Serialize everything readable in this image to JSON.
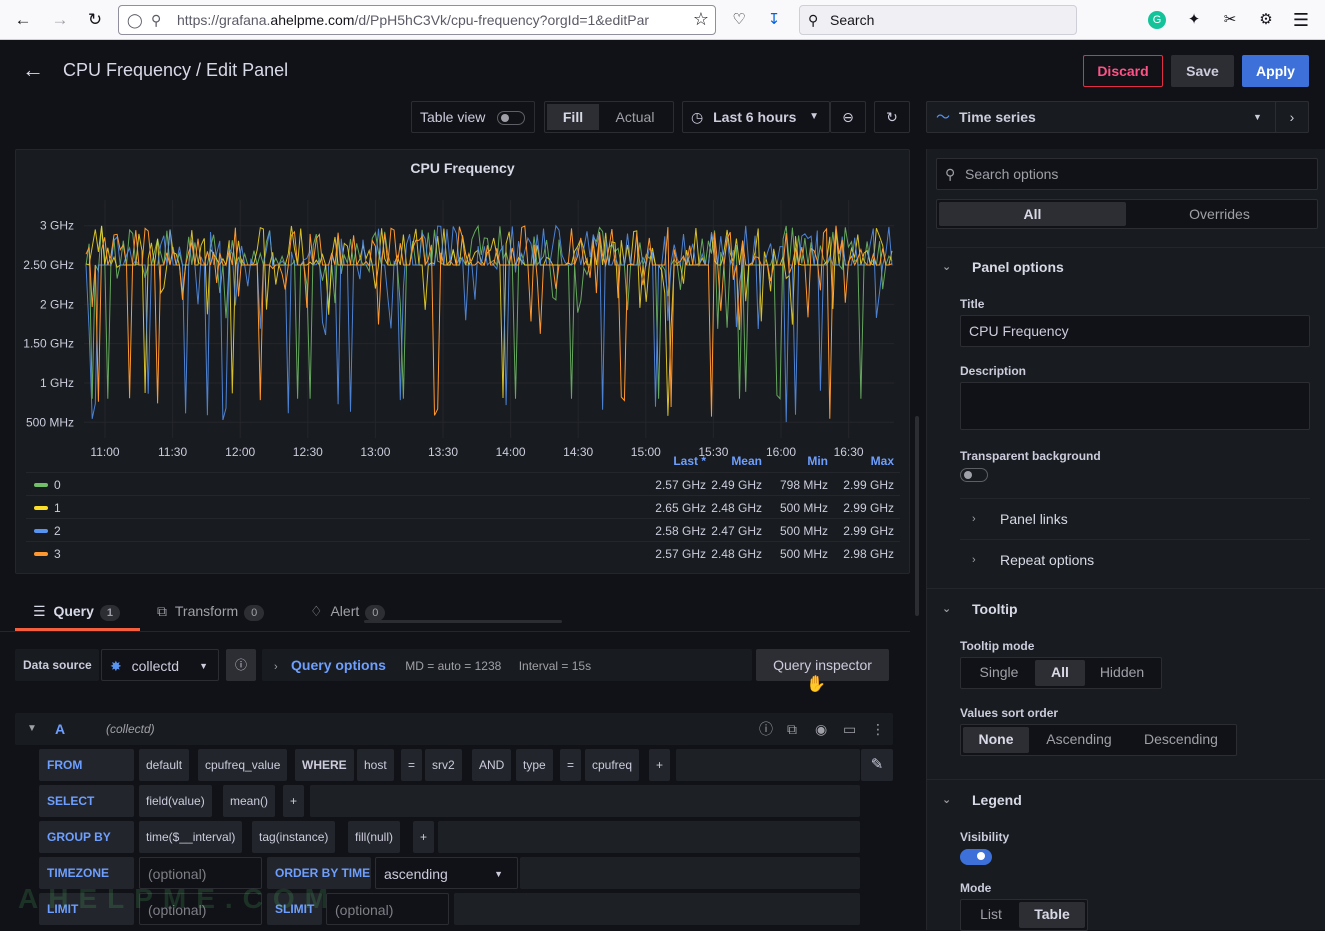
{
  "browser": {
    "url_prefix": "https://grafana.",
    "url_host": "ahelpme.com",
    "url_path": "/d/PpH5hC3Vk/cpu-frequency?orgId=1&editPar",
    "search_placeholder": "Search"
  },
  "header": {
    "title": "CPU Frequency / Edit Panel",
    "discard": "Discard",
    "save": "Save",
    "apply": "Apply"
  },
  "toolbar": {
    "table_view": "Table view",
    "fill": "Fill",
    "actual": "Actual",
    "time_range": "Last 6 hours"
  },
  "viz": {
    "name": "Time series"
  },
  "panel": {
    "title": "CPU Frequency"
  },
  "chart_data": {
    "type": "line",
    "title": "CPU Frequency",
    "y_ticks": [
      "3 GHz",
      "2.50 GHz",
      "2 GHz",
      "1.50 GHz",
      "1 GHz",
      "500 MHz"
    ],
    "x_ticks": [
      "11:00",
      "11:30",
      "12:00",
      "12:30",
      "13:00",
      "13:30",
      "14:00",
      "14:30",
      "15:00",
      "15:30",
      "16:00",
      "16:30"
    ],
    "ylim": [
      0.3,
      3.2
    ],
    "grid": true,
    "legend_placement": "bottom",
    "series": [
      {
        "name": "0",
        "color": "#73bf69",
        "last": "2.57 GHz",
        "mean": "2.49 GHz",
        "min": "798 MHz",
        "max": "2.99 GHz"
      },
      {
        "name": "1",
        "color": "#fade2a",
        "last": "2.65 GHz",
        "mean": "2.48 GHz",
        "min": "500 MHz",
        "max": "2.99 GHz"
      },
      {
        "name": "2",
        "color": "#5794f2",
        "last": "2.58 GHz",
        "mean": "2.47 GHz",
        "min": "500 MHz",
        "max": "2.99 GHz"
      },
      {
        "name": "3",
        "color": "#ff9830",
        "last": "2.57 GHz",
        "mean": "2.48 GHz",
        "min": "500 MHz",
        "max": "2.98 GHz"
      }
    ],
    "legend_columns": [
      "Last *",
      "Mean",
      "Min",
      "Max"
    ]
  },
  "tabs": [
    {
      "label": "Query",
      "count": "1"
    },
    {
      "label": "Transform",
      "count": "0"
    },
    {
      "label": "Alert",
      "count": "0"
    }
  ],
  "query": {
    "datasource_label": "Data source",
    "datasource": "collectd",
    "query_options": "Query options",
    "md": "MD = auto = 1238",
    "interval": "Interval = 15s",
    "inspector": "Query inspector",
    "ref": "A",
    "ref_ds": "(collectd)",
    "from_label": "FROM",
    "from": [
      "default",
      "cpufreq_value"
    ],
    "where_label": "WHERE",
    "where": [
      "host",
      "=",
      "srv2",
      "AND",
      "type",
      "=",
      "cpufreq",
      "+"
    ],
    "select_label": "SELECT",
    "select": [
      "field(value)",
      "mean()",
      "+"
    ],
    "groupby_label": "GROUP BY",
    "groupby": [
      "time($__interval)",
      "tag(instance)",
      "fill(null)",
      "+"
    ],
    "timezone_label": "TIMEZONE",
    "optional": "(optional)",
    "orderby_label": "ORDER BY TIME",
    "orderby": "ascending",
    "limit_label": "LIMIT",
    "slimit_label": "SLIMIT"
  },
  "options": {
    "search_placeholder": "Search options",
    "all": "All",
    "overrides": "Overrides",
    "panel_options": "Panel options",
    "title_label": "Title",
    "title_value": "CPU Frequency",
    "description_label": "Description",
    "transparent_label": "Transparent background",
    "panel_links": "Panel links",
    "repeat_options": "Repeat options",
    "tooltip": "Tooltip",
    "tooltip_mode_label": "Tooltip mode",
    "tooltip_modes": [
      "Single",
      "All",
      "Hidden"
    ],
    "sort_label": "Values sort order",
    "sort_modes": [
      "None",
      "Ascending",
      "Descending"
    ],
    "legend": "Legend",
    "visibility_label": "Visibility",
    "mode_label": "Mode",
    "modes": [
      "List",
      "Table"
    ]
  },
  "watermark": "AHELPME.COM"
}
